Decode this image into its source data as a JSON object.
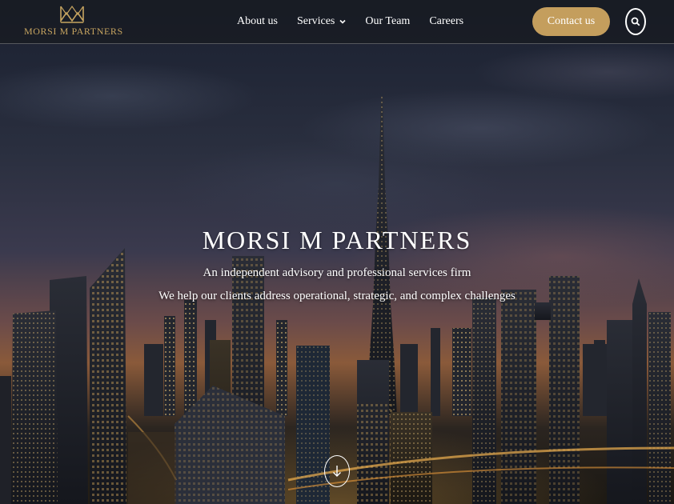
{
  "brand": {
    "name": "MORSI M PARTNERS",
    "logo_icon": "crown-m-logo-icon",
    "accent_color": "#c49e5d"
  },
  "nav": {
    "items": [
      {
        "label": "About us"
      },
      {
        "label": "Services",
        "has_dropdown": true
      },
      {
        "label": "Our Team"
      },
      {
        "label": "Careers"
      }
    ],
    "contact_label": "Contact us",
    "search_icon": "search-icon"
  },
  "hero": {
    "title": "MORSI M PARTNERS",
    "subtitle": "An independent advisory and professional services firm",
    "tagline": "We help our clients address operational, strategic, and complex challenges",
    "background": "Dubai skyline at dusk",
    "scroll_icon": "arrow-down-icon"
  }
}
